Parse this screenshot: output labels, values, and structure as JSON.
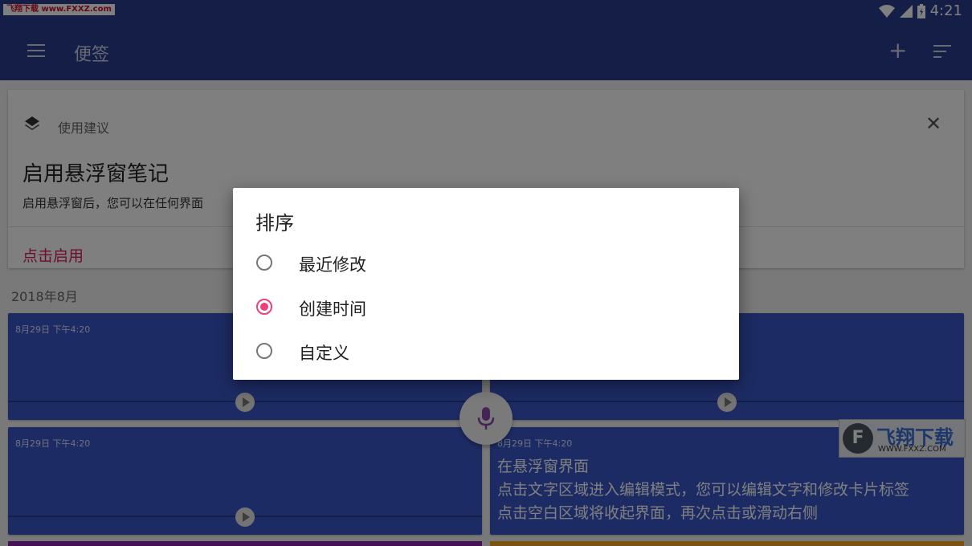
{
  "status_bar": {
    "time": "4:21",
    "watermark": "飞翔下载 www.FXXZ.com"
  },
  "app_bar": {
    "title": "便签"
  },
  "tip_card": {
    "header": "使用建议",
    "title": "启用悬浮窗笔记",
    "description": "启用悬浮窗后，您可以在任何界面",
    "action": "点击启用"
  },
  "month_label": "2018年8月",
  "notes": [
    {
      "date": "8月29日 下午4:20",
      "title": "",
      "lines": []
    },
    {
      "date": "",
      "title": "",
      "lines": []
    },
    {
      "date": "8月29日 下午4:20",
      "title": "",
      "lines": []
    },
    {
      "date": "8月29日 下午4:20",
      "title": "在悬浮窗界面",
      "lines": [
        "点击文字区域进入编辑模式，您可以编辑文字和修改卡片标签",
        "点击空白区域将收起界面，再次点击或滑动右侧"
      ]
    }
  ],
  "colors": {
    "primary": "#2b3d8f",
    "note_blue": "#3a57c8",
    "accent": "#ec407a",
    "action_text": "#d81b60"
  },
  "dialog": {
    "title": "排序",
    "options": [
      {
        "label": "最近修改",
        "selected": false
      },
      {
        "label": "创建时间",
        "selected": true
      },
      {
        "label": "自定义",
        "selected": false
      }
    ]
  },
  "watermark_logo": {
    "text": "飞翔下载",
    "url": "WWW.FXXZ.COM"
  }
}
